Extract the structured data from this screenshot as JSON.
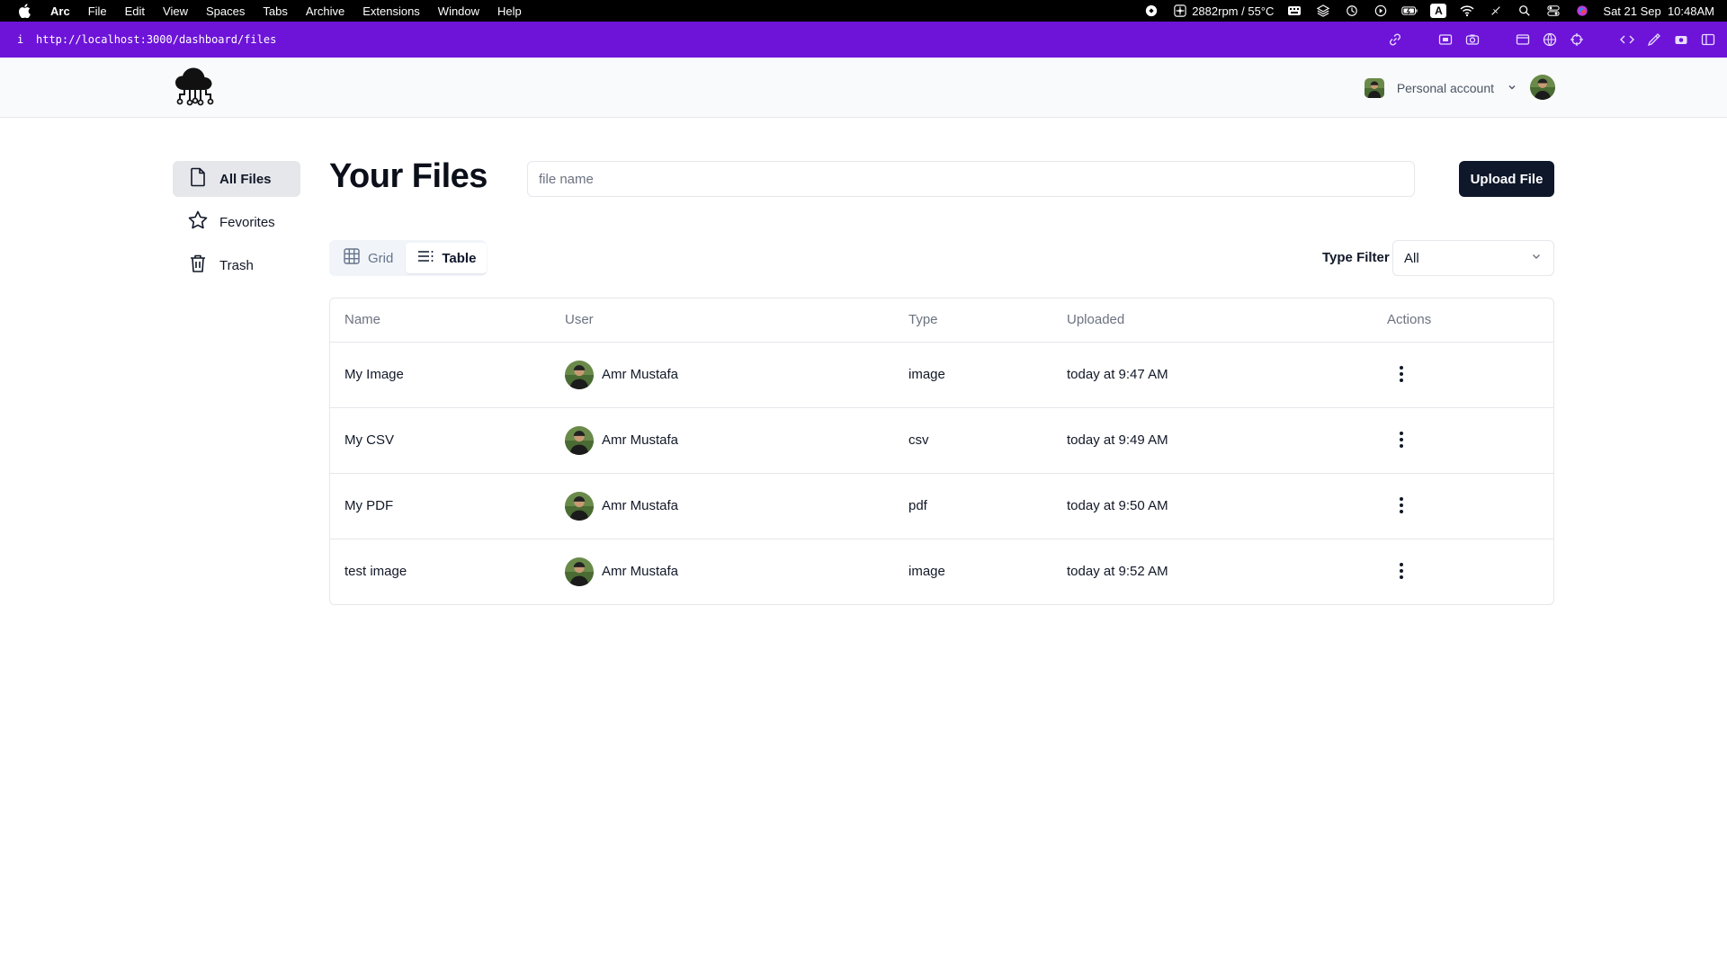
{
  "menubar": {
    "apple_icon": "apple-logo-icon",
    "items": [
      "Arc",
      "File",
      "Edit",
      "View",
      "Spaces",
      "Tabs",
      "Archive",
      "Extensions",
      "Window",
      "Help"
    ],
    "fan_status": "2882rpm / 55°C",
    "keyboard_input": "A",
    "datetime": "Sat 21 Sep  10:48AM"
  },
  "browser": {
    "info": "i",
    "url": "http://localhost:3000/dashboard/files"
  },
  "header": {
    "logo": "cloud-network-logo",
    "account_label": "Personal account"
  },
  "sidebar": {
    "items": [
      {
        "label": "All Files",
        "icon": "file-icon",
        "active": true
      },
      {
        "label": "Fevorites",
        "icon": "star-icon",
        "active": false
      },
      {
        "label": "Trash",
        "icon": "trash-icon",
        "active": false
      }
    ]
  },
  "main": {
    "title": "Your Files",
    "search_placeholder": "file name",
    "upload_label": "Upload File",
    "view_toggle": {
      "grid_label": "Grid",
      "table_label": "Table",
      "active": "Table"
    },
    "type_filter": {
      "label": "Type Filter",
      "value": "All"
    }
  },
  "table": {
    "headers": [
      "Name",
      "User",
      "Type",
      "Uploaded",
      "Actions"
    ],
    "rows": [
      {
        "name": "My Image",
        "user": "Amr Mustafa",
        "type": "image",
        "uploaded": "today at 9:47 AM"
      },
      {
        "name": "My CSV",
        "user": "Amr Mustafa",
        "type": "csv",
        "uploaded": "today at 9:49 AM"
      },
      {
        "name": "My PDF",
        "user": "Amr Mustafa",
        "type": "pdf",
        "uploaded": "today at 9:50 AM"
      },
      {
        "name": "test image",
        "user": "Amr Mustafa",
        "type": "image",
        "uploaded": "today at 9:52 AM"
      }
    ]
  },
  "colors": {
    "menubar": "#000000",
    "urlbar": "#6d14d8",
    "primary_button": "#0f172a",
    "header_bg": "#f9fafb",
    "border": "#e5e7eb"
  }
}
